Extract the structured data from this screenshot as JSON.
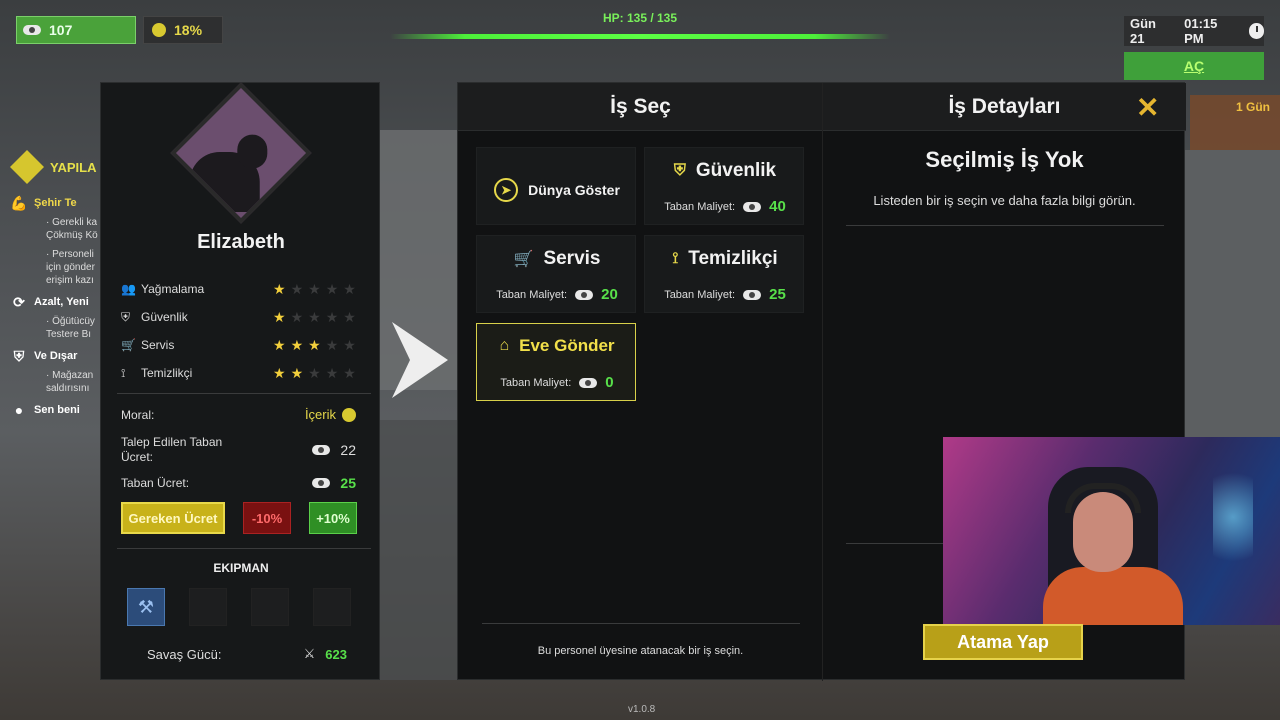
{
  "hud": {
    "money": "107",
    "mood_percent": "18%",
    "hp": "HP: 135 / 135",
    "day": "Gün 21",
    "time": "01:15 PM",
    "hunger": "AÇ",
    "one_day": "1 Gün"
  },
  "quests": {
    "header": "YAPILA",
    "items": [
      {
        "title": "Şehir Te",
        "sub": [
          "· Gerekli ka",
          "Çökmüş Kö",
          "· Personeli",
          "için gönder",
          "erişim kazı"
        ]
      },
      {
        "title": "Azalt, Yeni",
        "sub": [
          "· Öğütücüy",
          "Testere Bı"
        ]
      },
      {
        "title": "Ve Dışar",
        "sub": [
          "· Mağazan",
          "saldırısını"
        ]
      },
      {
        "title": "Sen beni",
        "sub": []
      }
    ]
  },
  "character": {
    "name": "Elizabeth",
    "skills": [
      {
        "name": "Yağmalama",
        "stars": 1
      },
      {
        "name": "Güvenlik",
        "stars": 1
      },
      {
        "name": "Servis",
        "stars": 3
      },
      {
        "name": "Temizlikçi",
        "stars": 2
      }
    ],
    "morale_label": "Moral:",
    "morale_value": "İçerik",
    "requested_wage_label": "Talep Edilen Taban Ücret:",
    "requested_wage_value": "22",
    "base_wage_label": "Taban Ücret:",
    "base_wage_value": "25",
    "btn_required": "Gereken Ücret",
    "btn_minus": "-10%",
    "btn_plus": "+10%",
    "equipment_title": "EKIPMAN",
    "combat_power_label": "Savaş Gücü:",
    "combat_power_value": "623"
  },
  "jobs": {
    "title_left": "İş Seç",
    "title_right": "İş Detayları",
    "cost_label": "Taban Maliyet:",
    "cards": [
      {
        "name": "Dünya Göster",
        "cost": null,
        "icon": "compass-icon"
      },
      {
        "name": "Güvenlik",
        "cost": "40",
        "icon": "shield-icon"
      },
      {
        "name": "Servis",
        "cost": "20",
        "icon": "cart-icon"
      },
      {
        "name": "Temizlikçi",
        "cost": "25",
        "icon": "broom-icon"
      },
      {
        "name": "Eve Gönder",
        "cost": "0",
        "icon": "home-icon"
      }
    ],
    "footer": "Bu personel üyesine atanacak bir iş seçin.",
    "detail_title": "Seçilmiş İş Yok",
    "detail_desc": "Listeden bir iş seçin ve daha fazla bilgi görün.",
    "assign_button": "Atama Yap"
  },
  "version": "v1.0.8",
  "colors": {
    "accent_yellow": "#e6d84a",
    "money_green": "#58e04a",
    "hp_green": "#5cff44",
    "danger_red": "#7a1111"
  }
}
